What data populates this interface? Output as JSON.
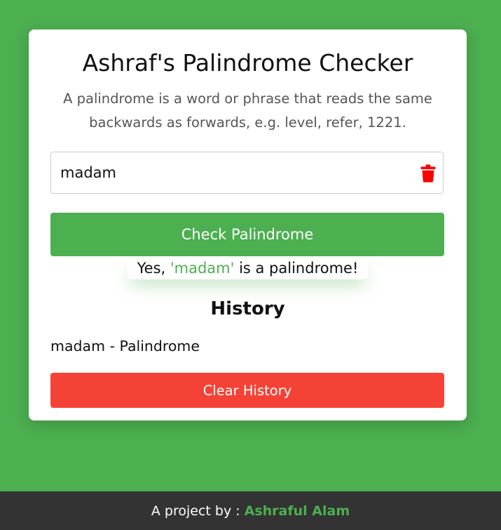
{
  "app": {
    "title": "Ashraf's Palindrome Checker",
    "description": "A palindrome is a word or phrase that reads the same backwards as forwards, e.g. level, refer, 1221."
  },
  "input": {
    "value": "madam",
    "clear_icon": "trash-icon"
  },
  "check_button": {
    "label": "Check Palindrome"
  },
  "result": {
    "prefix": "Yes, ",
    "word": "'madam'",
    "suffix": " is a palindrome!"
  },
  "history": {
    "heading": "History",
    "items": [
      {
        "text": "madam - Palindrome"
      }
    ],
    "clear_label": "Clear History"
  },
  "footer": {
    "prefix": "A project by :",
    "author": "Ashraful Alam"
  },
  "colors": {
    "background": "#4caf50",
    "primary": "#4caf50",
    "danger": "#f44336",
    "icon_danger": "#ff0000",
    "footer": "#333333"
  }
}
